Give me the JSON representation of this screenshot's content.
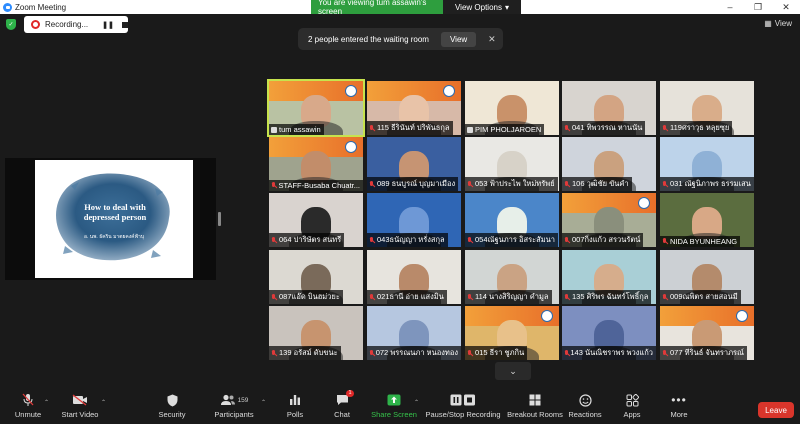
{
  "window": {
    "title": "Zoom Meeting",
    "share_banner": "You are viewing tum assawin's screen",
    "view_options": "View Options"
  },
  "recording": {
    "label": "Recording..."
  },
  "view_button": "View",
  "waiting_room": {
    "message": "2 people entered the waiting room",
    "view_label": "View"
  },
  "shared_slide": {
    "title": "How to deal with depressed person",
    "subtitle": "อ. นพ. ธัคริน มาตยคงค์ฟ้าบุ"
  },
  "participants": [
    {
      "name": "tum assawin",
      "muted": false,
      "bg": "#b9c2a3",
      "skin": "#d8a98a",
      "banner": true
    },
    {
      "name": "115 ธีรินันท์ ปริพันธกุล",
      "muted": true,
      "bg": "#d7b9a8",
      "skin": "#e8c3a8",
      "banner": true
    },
    {
      "name": "PIM PHOLJAROEN",
      "muted": false,
      "bg": "#efe7d6",
      "skin": "#c9926a",
      "banner": false
    },
    {
      "name": "041 ทิพวรรณ หานนัน",
      "muted": true,
      "bg": "#d8d4cf",
      "skin": "#d3a483",
      "banner": false
    },
    {
      "name": "119ศราวุธ หลุยซุย",
      "muted": true,
      "bg": "#e6e2da",
      "skin": "#d9ad8a",
      "banner": false
    },
    {
      "name": "STAFF-Busaba Chuatr...",
      "muted": true,
      "bg": "#9fa38e",
      "skin": "#c28d6a",
      "banner": true
    },
    {
      "name": "089 ธนบูรณ์ บุญมาเมือง",
      "muted": true,
      "bg": "#3a5fa0",
      "skin": "#c69473",
      "banner": false
    },
    {
      "name": "053 ฟ้าประไพ ใหม่ทรัพย์",
      "muted": true,
      "bg": "#e9e8e4",
      "skin": "#d7d2c8",
      "banner": false
    },
    {
      "name": "106 วุฒิชัย ขันคำ",
      "muted": true,
      "bg": "#cfd4dc",
      "skin": "#caa17f",
      "banner": false
    },
    {
      "name": "031 ณัฐนิภาพร ธรรมเสน",
      "muted": true,
      "bg": "#bdd3ea",
      "skin": "#8fb1d6",
      "banner": false
    },
    {
      "name": "064 ปาริษัตร สนทรี",
      "muted": true,
      "bg": "#d9d3cf",
      "skin": "#2a2a2a",
      "banner": false
    },
    {
      "name": "043ธนัญญา หรั่งสกุล",
      "muted": true,
      "bg": "#2f66b5",
      "skin": "#6e98d6",
      "banner": false
    },
    {
      "name": "054ณัฐนภาร อิสระสัมนา",
      "muted": true,
      "bg": "#4b86c9",
      "skin": "#e7efe9",
      "banner": false
    },
    {
      "name": "007กิ่งแก้ว สรวนรัตน์",
      "muted": true,
      "bg": "#a8ad96",
      "skin": "#8a8f7c",
      "banner": true
    },
    {
      "name": "NIDA BYUNHEANG",
      "muted": true,
      "bg": "#5b6d3f",
      "skin": "#d8a886",
      "banner": false
    },
    {
      "name": "087แอ๊ด บินฮม่วยะ",
      "muted": true,
      "bg": "#dcd9d2",
      "skin": "#7a6a5a",
      "banner": false
    },
    {
      "name": "021ธานี อ่าย แสงมิน",
      "muted": true,
      "bg": "#e7e4de",
      "skin": "#b98a6a",
      "banner": false
    },
    {
      "name": "114 นางสิริญญา คำมูล",
      "muted": true,
      "bg": "#d2d6d4",
      "skin": "#caa384",
      "banner": false
    },
    {
      "name": "135 ศิริพร ฉันทร์โพธิ์กุล",
      "muted": true,
      "bg": "#a9cfd6",
      "skin": "#d6ad8c",
      "banner": false
    },
    {
      "name": "009ณพิตร สายสอนมี",
      "muted": true,
      "bg": "#ccd0d4",
      "skin": "#b48b6c",
      "banner": false
    },
    {
      "name": "139 อรัสม์ ดับขนะ",
      "muted": true,
      "bg": "#c9c3bd",
      "skin": "#c7946f",
      "banner": false
    },
    {
      "name": "072 พรรณนภา หนองทอง",
      "muted": true,
      "bg": "#b6c7e0",
      "skin": "#7e95bd",
      "banner": false
    },
    {
      "name": "015 ธีรา ชูภกิน",
      "muted": true,
      "bg": "#dfb66a",
      "skin": "#e8c18a",
      "banner": true
    },
    {
      "name": "143 นันณิชราพร พวงแก้ว",
      "muted": true,
      "bg": "#7d8fc0",
      "skin": "#4f6499",
      "banner": false
    },
    {
      "name": "077 ทีรินธ์ จันทราภรณ์",
      "muted": true,
      "bg": "#e8e4dd",
      "skin": "#c99a75",
      "banner": true
    }
  ],
  "toolbar": {
    "unmute": "Unmute",
    "start_video": "Start Video",
    "security": "Security",
    "participants": "Participants",
    "participants_count": "159",
    "polls": "Polls",
    "chat": "Chat",
    "chat_badge": "1",
    "share_screen": "Share Screen",
    "record": "Pause/Stop Recording",
    "breakout": "Breakout Rooms",
    "reactions": "Reactions",
    "apps": "Apps",
    "more": "More",
    "leave": "Leave"
  }
}
